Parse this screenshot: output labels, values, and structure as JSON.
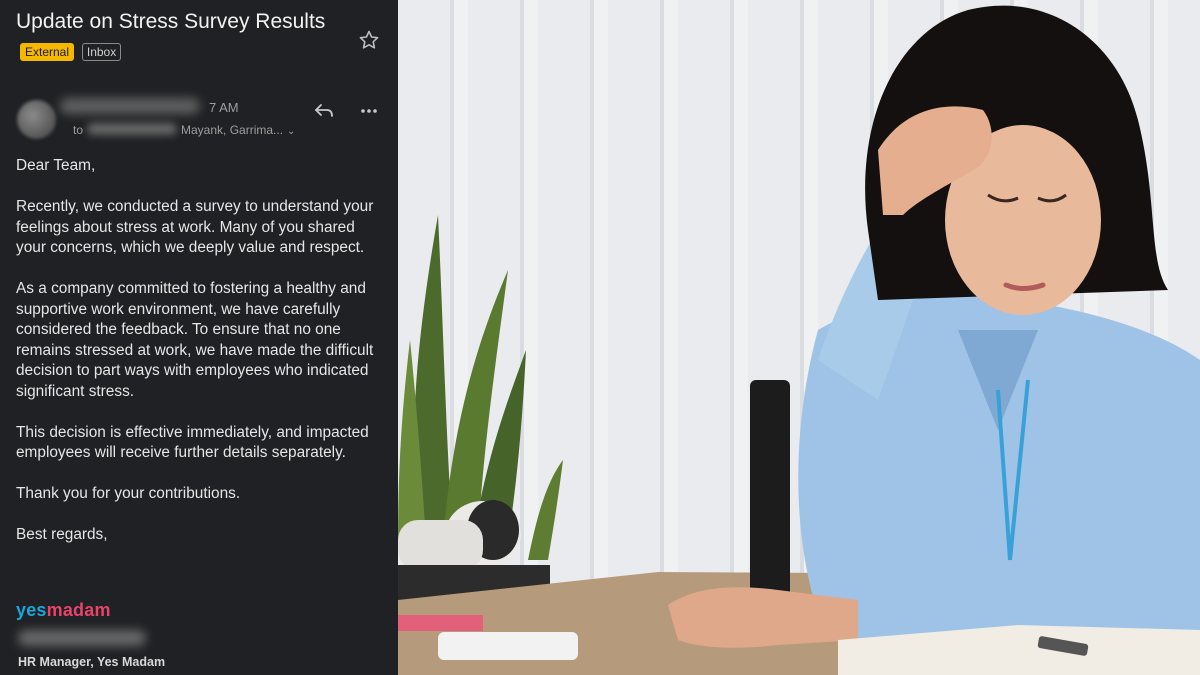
{
  "email": {
    "subject": "Update on Stress Survey Results",
    "labels": {
      "external": "External",
      "inbox": "Inbox"
    },
    "time": "7 AM",
    "to_prefix": "to",
    "to_names": "Mayank, Garrima...",
    "icons": [
      "star-icon",
      "reply-icon",
      "more-icon",
      "chevron-down-icon"
    ],
    "greeting": "Dear Team,",
    "paragraphs": [
      "Recently, we conducted a survey to understand your feelings about stress at work. Many of you shared your concerns, which we deeply value and respect.",
      "As a company committed to fostering a healthy and supportive work environment, we have carefully considered the feedback. To ensure that no one remains stressed at work, we have made the difficult decision to part ways with employees who indicated significant stress.",
      "This decision is effective immediately, and impacted employees will receive further details separately.",
      "Thank you for your contributions."
    ],
    "closing": "Best regards,",
    "logo": {
      "yes": "yes",
      "madam": "madam"
    },
    "signature_title": "HR Manager, Yes Madam"
  },
  "colors": {
    "panel_bg": "#1f2124",
    "external_badge": "#f5b800",
    "logo_blue": "#1aa6d8",
    "logo_pink": "#e8436a"
  }
}
